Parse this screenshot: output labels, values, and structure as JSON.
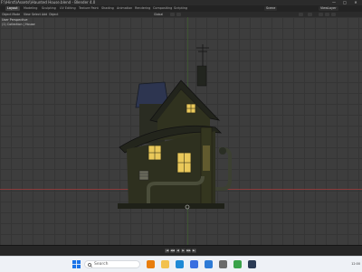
{
  "window": {
    "title": "F:\\\\Hirst\\\\Assets\\\\Haunted House.blend - Blender 4.0",
    "controls": [
      "—",
      "□",
      "✕"
    ]
  },
  "menubar": {
    "tabs": [
      "Layout",
      "Modeling",
      "Sculpting",
      "UV Editing",
      "Texture Paint",
      "Shading",
      "Animation",
      "Rendering",
      "Compositing",
      "Scripting"
    ],
    "active_tab": "Layout",
    "scene_label": "Scene",
    "view_layer_label": "ViewLayer"
  },
  "viewport_header": {
    "mode": "Object Mode",
    "menus": [
      "View",
      "Select",
      "Add",
      "Object"
    ],
    "transform": "Global"
  },
  "viewport_overlay": {
    "view_name": "User Perspective",
    "collection": "(1) Collection | House"
  },
  "timeline": {
    "buttons": [
      "|◀",
      "◀◀",
      "◀",
      "▶",
      "▶▶",
      "▶|"
    ]
  },
  "taskbar": {
    "search_label": "Search",
    "time": "12:00",
    "apps": [
      "blender-app",
      "folder-app",
      "edge-app",
      "store-app",
      "mail-app",
      "settings-app",
      "chrome-app",
      "steam-app"
    ],
    "app_colors": [
      "#e87d0d",
      "#f2c14e",
      "#1f8ad6",
      "#3a6fe0",
      "#2e7bd6",
      "#6b6b6b",
      "#3aa24a",
      "#2a3b55"
    ]
  },
  "colors": {
    "window_glow": "#e9c85a",
    "axis_x": "#8a3a3a",
    "roof": "#2d3550"
  }
}
